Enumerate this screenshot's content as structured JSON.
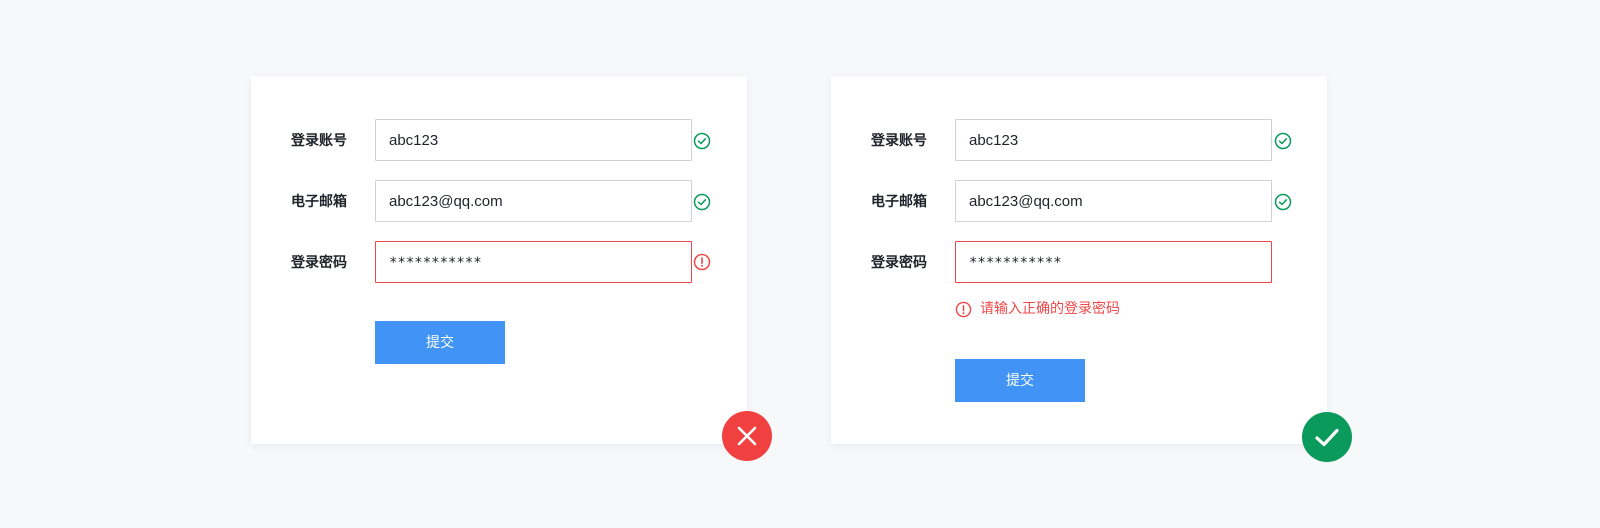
{
  "colors": {
    "success": "#0a9a5c",
    "error": "#f04848",
    "primary": "#4194f5"
  },
  "form_wrong": {
    "rows": [
      {
        "label": "登录账号",
        "value": "abc123",
        "state_icon": "check-circle-icon"
      },
      {
        "label": "电子邮箱",
        "value": "abc123@qq.com",
        "state_icon": "check-circle-icon"
      },
      {
        "label": "登录密码",
        "value": "***********",
        "state_icon": "exclamation-circle-icon"
      }
    ],
    "submit_label": "提交",
    "verdict_icon": "cross-icon"
  },
  "form_right": {
    "rows": [
      {
        "label": "登录账号",
        "value": "abc123",
        "state_icon": "check-circle-icon"
      },
      {
        "label": "电子邮箱",
        "value": "abc123@qq.com",
        "state_icon": "check-circle-icon"
      },
      {
        "label": "登录密码",
        "value": "***********"
      }
    ],
    "error_message": "请输入正确的登录密码",
    "submit_label": "提交",
    "verdict_icon": "check-icon"
  }
}
